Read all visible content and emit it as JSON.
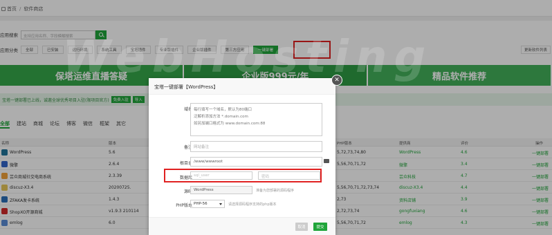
{
  "breadcrumb": {
    "home": "首页",
    "current": "软件商店"
  },
  "search": {
    "label": "应用搜索",
    "placeholder": "支持应用名称、字段模糊搜索"
  },
  "categories": {
    "label": "应用分类",
    "items": [
      "全部",
      "已安装",
      "运行环境",
      "系统工具",
      "宝塔插件",
      "专业版插件",
      "企业版插件",
      "第三方应用",
      "一键部署"
    ],
    "active_index": 8,
    "update_label": "更新软件列表"
  },
  "banners": [
    "保塔运维直播答疑",
    "企业版999元/年",
    "精品软件推荐"
  ],
  "notice": {
    "text": "宝塔一键部署已上线，诚邀全球优秀项目入驻(限项目官方)",
    "tag1": "免费入驻",
    "tag2": "导入"
  },
  "filter_tabs": [
    "全部",
    "建站",
    "商城",
    "论坛",
    "博客",
    "微信",
    "框架",
    "其它"
  ],
  "table": {
    "headers": [
      "名称",
      "版本",
      "PHP版本",
      "提供商",
      "评价",
      "操作"
    ],
    "rows": [
      {
        "name": "WordPress",
        "version": "5.6",
        "php": "5,72,73,74,80",
        "provider": "WordPress",
        "rating": "4.6",
        "action": "一键部署",
        "icon_color": "#21759b"
      },
      {
        "name": "微擎",
        "version": "2.6.4",
        "php": "5,56,70,71,72",
        "provider": "微擎",
        "rating": "3.4",
        "action": "一键部署",
        "icon_color": "#3366cc"
      },
      {
        "name": "芸众商城社交电商系统",
        "version": "2.3.39",
        "php": "",
        "provider": "芸众科技",
        "rating": "4.7",
        "action": "一键部署",
        "icon_color": "#f2a23a"
      },
      {
        "name": "discuz-X3.4",
        "version": "20200725.",
        "php": "5,56,70,71,72,73,74",
        "provider": "discuz-X3.4",
        "rating": "4.4",
        "action": "一键部署",
        "icon_color": "#e8c75a"
      },
      {
        "name": "ZFAKA发卡系统",
        "version": "1.4.3",
        "php": "2,73",
        "provider": "资料店铺",
        "rating": "3.9",
        "action": "一键部署",
        "icon_color": "#2a6fb8"
      },
      {
        "name": "ShopXO开源商城",
        "version": "v1.9.3 210114",
        "php": "2,72,73,74",
        "provider": "gongfuxiang",
        "rating": "4.6",
        "action": "一键部署",
        "icon_color": "#d12a2a"
      },
      {
        "name": "emlog",
        "version": "6.0",
        "php": "5,56,70,71,72",
        "provider": "emlog",
        "rating": "4.3",
        "action": "一键部署",
        "icon_color": "#5b8dd6"
      }
    ]
  },
  "watermark": "WebHosting",
  "modal": {
    "title": "宝塔一键部署【WordPress】",
    "domain_label": "域名",
    "domain_hints": [
      "每行填写一个域名，默认为80端口",
      "泛解析添加方法 *.domain.com",
      "如另加端口格式为 www.domain.com:88"
    ],
    "remark_label": "备注",
    "remark_placeholder": "网站备注",
    "root_label": "根目录",
    "root_value": "/www/wwwroot",
    "db_label": "数据库",
    "db_user_placeholder": "sql_user",
    "db_pass_placeholder": "密码",
    "source_label": "源码",
    "source_value": "WordPress",
    "source_hint": "准备为您部署的源码程序",
    "php_label": "PHP版本",
    "php_value": "PHP-56",
    "php_hint": "请选择源码程序支持的php版本",
    "cancel_label": "取消",
    "submit_label": "提交"
  }
}
